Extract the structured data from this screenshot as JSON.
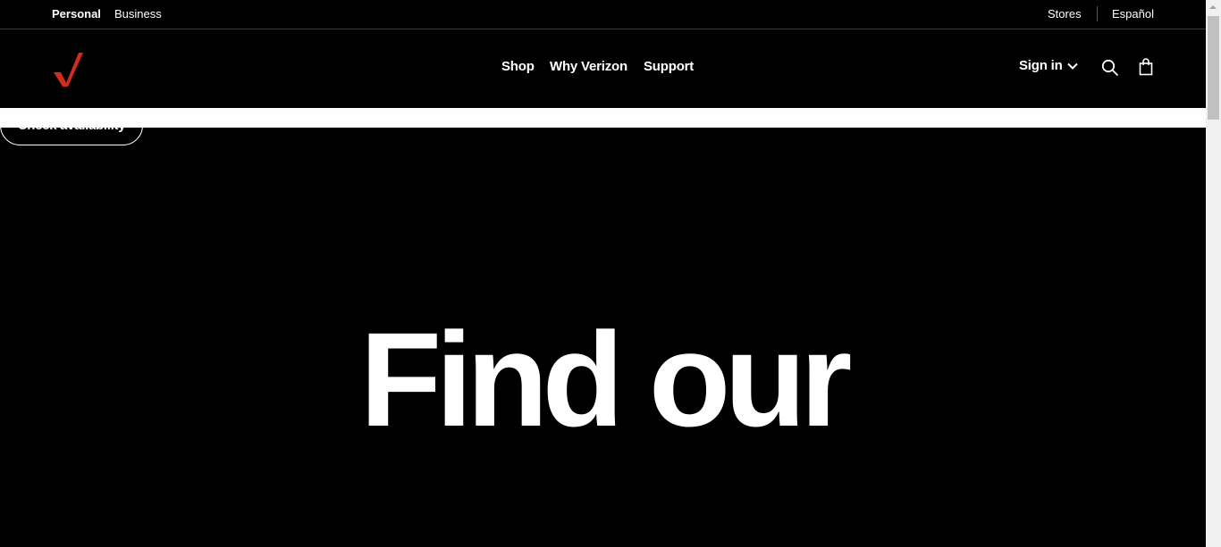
{
  "utility": {
    "personal": "Personal",
    "business": "Business",
    "stores": "Stores",
    "espanol": "Español"
  },
  "header": {
    "logo_icon": "verizon-check-icon",
    "brand_color": "#d52b1e",
    "nav": [
      {
        "label": "Shop"
      },
      {
        "label": "Why Verizon"
      },
      {
        "label": "Support"
      }
    ],
    "signin": "Sign in",
    "search_icon": "search-icon",
    "cart_icon": "shopping-bag-icon"
  },
  "check_availability": "Check availability",
  "hero": {
    "title": "Find our"
  }
}
